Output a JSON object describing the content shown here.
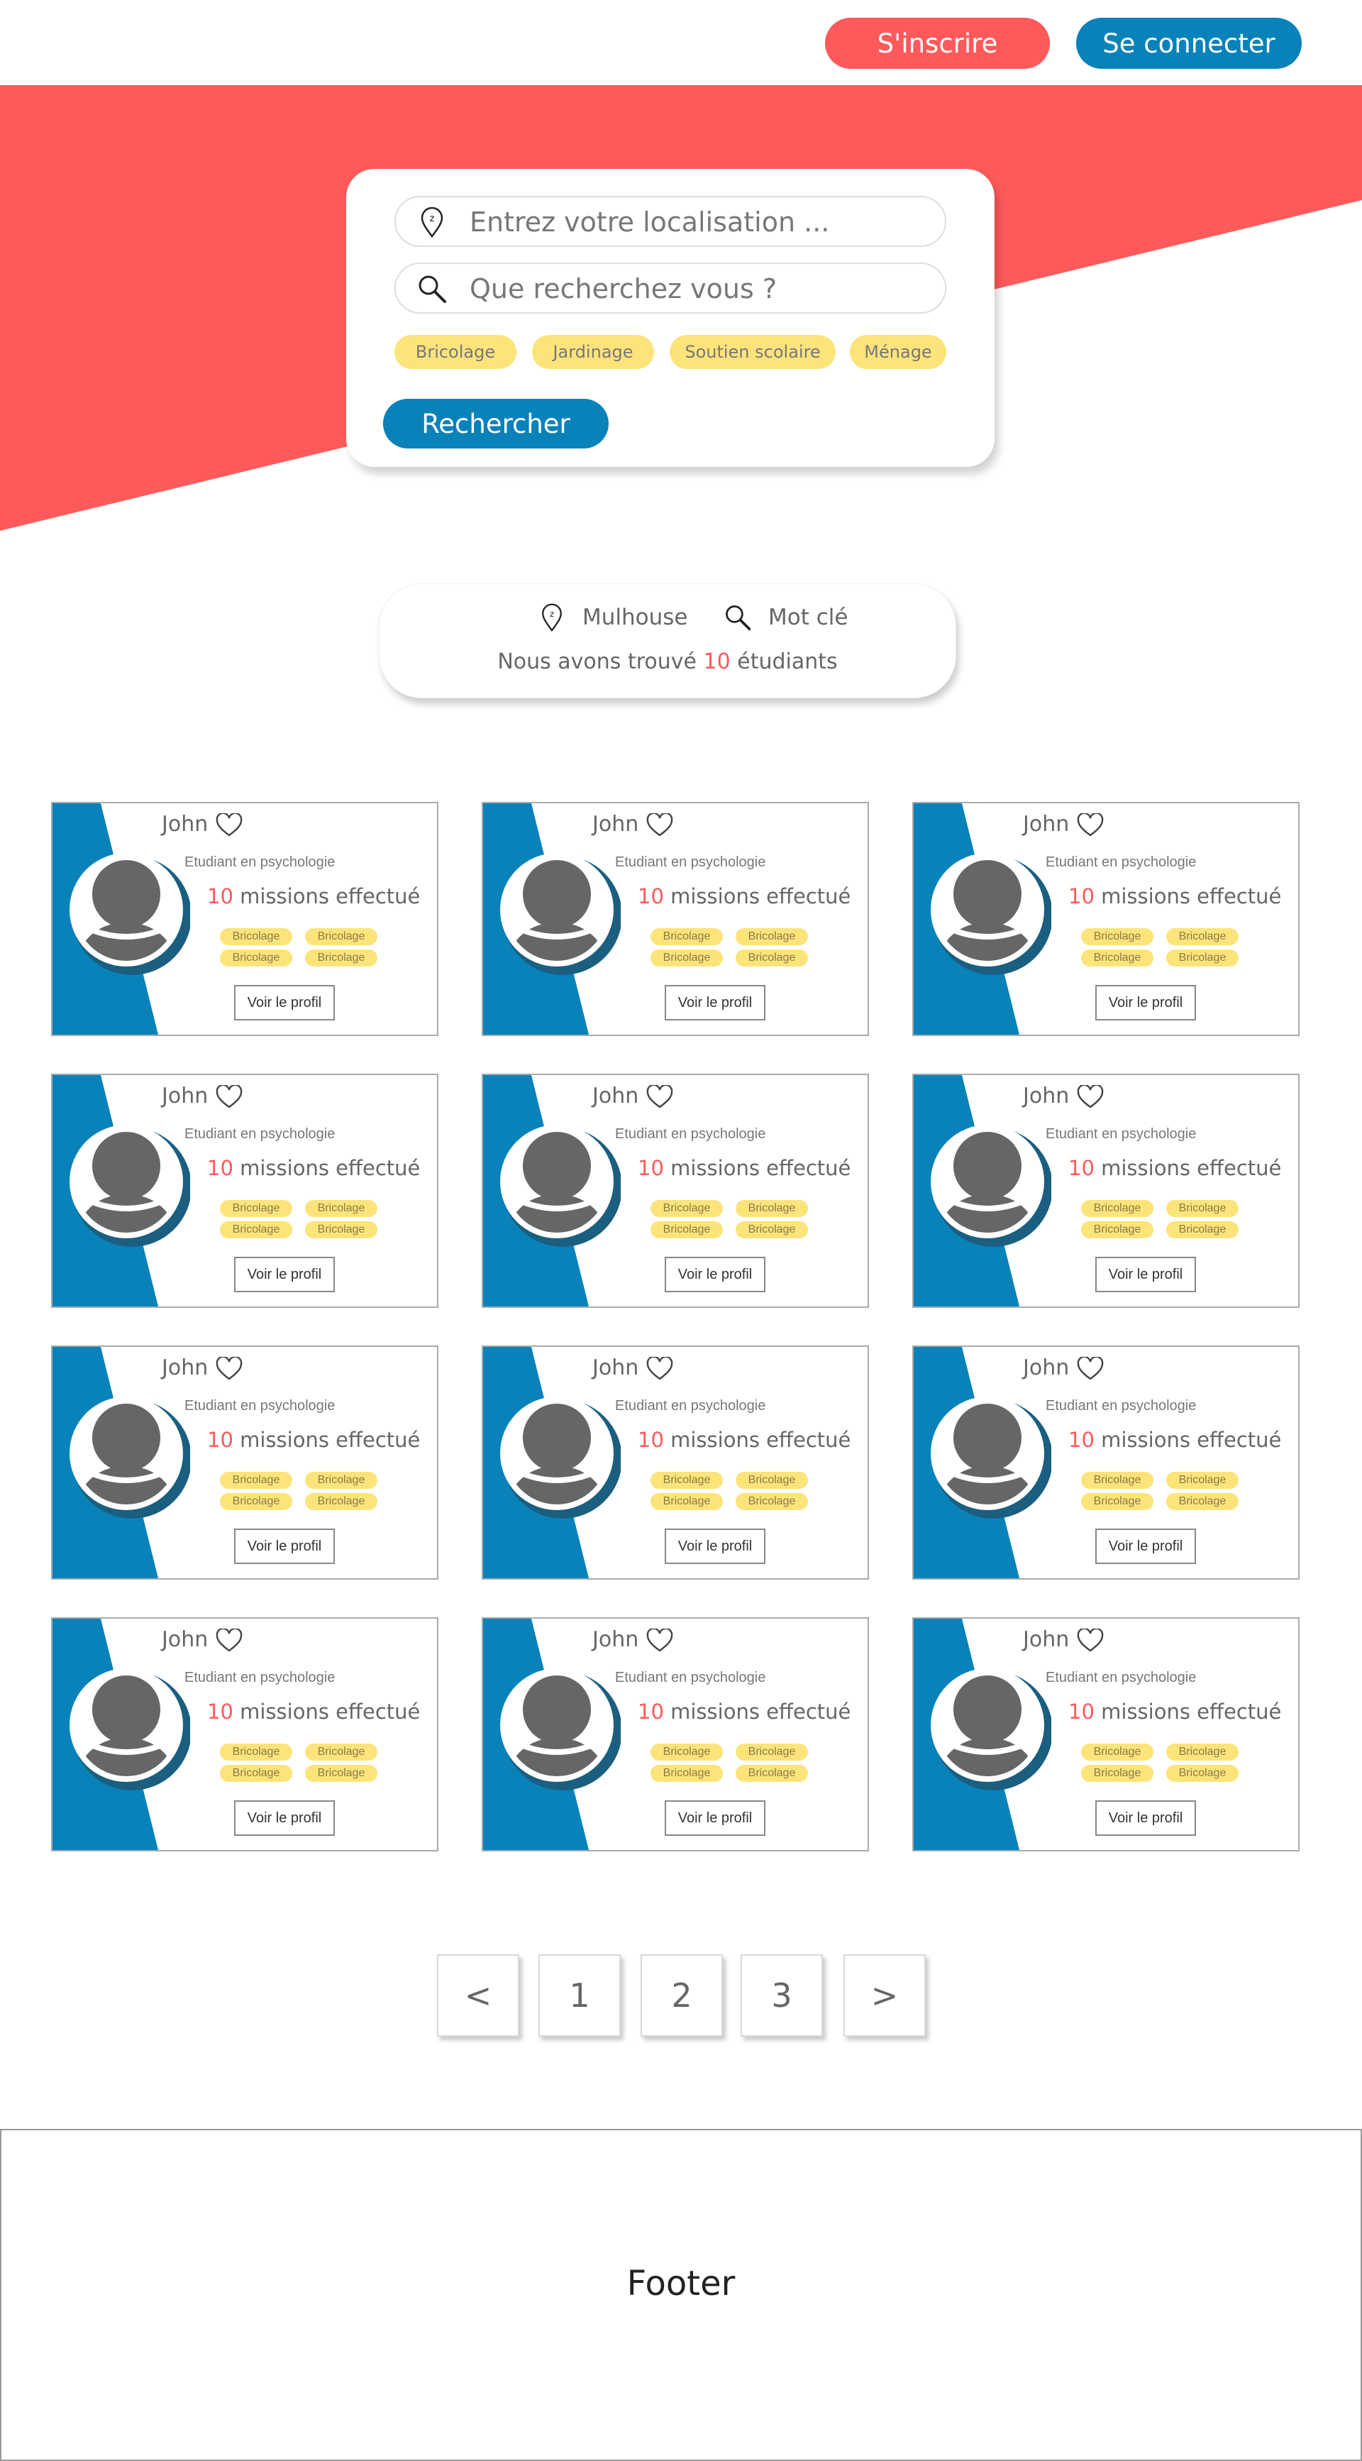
{
  "header": {
    "register_label": "S'inscrire",
    "login_label": "Se connecter"
  },
  "colors": {
    "brand_red": "#fe5a5b",
    "brand_blue": "#0882b9",
    "tag_yellow": "#fde47a",
    "avatar_gray": "#666666"
  },
  "search": {
    "location_placeholder": "Entrez votre localisation ...",
    "location_icon": "map-pin-icon",
    "query_placeholder": "Que recherchez vous ?",
    "query_icon": "search-icon",
    "categories": [
      "Bricolage",
      "Jardinage",
      "Soutien scolaire",
      "Ménage"
    ],
    "submit_label": "Rechercher"
  },
  "summary": {
    "location": "Mulhouse",
    "keyword": "Mot clé",
    "found_prefix": "Nous avons trouvé",
    "found_count": "10",
    "found_suffix": "étudiants"
  },
  "cards": [
    {
      "name": "John",
      "study": "Etudiant en psychologie",
      "missions_count": "10",
      "missions_label": "missions effectué",
      "tags": [
        "Bricolage",
        "Bricolage",
        "Bricolage",
        "Bricolage"
      ],
      "button": "Voir le profil"
    },
    {
      "name": "John",
      "study": "Etudiant en psychologie",
      "missions_count": "10",
      "missions_label": "missions effectué",
      "tags": [
        "Bricolage",
        "Bricolage",
        "Bricolage",
        "Bricolage"
      ],
      "button": "Voir le profil"
    },
    {
      "name": "John",
      "study": "Etudiant en psychologie",
      "missions_count": "10",
      "missions_label": "missions effectué",
      "tags": [
        "Bricolage",
        "Bricolage",
        "Bricolage",
        "Bricolage"
      ],
      "button": "Voir le profil"
    },
    {
      "name": "John",
      "study": "Etudiant en psychologie",
      "missions_count": "10",
      "missions_label": "missions effectué",
      "tags": [
        "Bricolage",
        "Bricolage",
        "Bricolage",
        "Bricolage"
      ],
      "button": "Voir le profil"
    },
    {
      "name": "John",
      "study": "Etudiant en psychologie",
      "missions_count": "10",
      "missions_label": "missions effectué",
      "tags": [
        "Bricolage",
        "Bricolage",
        "Bricolage",
        "Bricolage"
      ],
      "button": "Voir le profil"
    },
    {
      "name": "John",
      "study": "Etudiant en psychologie",
      "missions_count": "10",
      "missions_label": "missions effectué",
      "tags": [
        "Bricolage",
        "Bricolage",
        "Bricolage",
        "Bricolage"
      ],
      "button": "Voir le profil"
    },
    {
      "name": "John",
      "study": "Etudiant en psychologie",
      "missions_count": "10",
      "missions_label": "missions effectué",
      "tags": [
        "Bricolage",
        "Bricolage",
        "Bricolage",
        "Bricolage"
      ],
      "button": "Voir le profil"
    },
    {
      "name": "John",
      "study": "Etudiant en psychologie",
      "missions_count": "10",
      "missions_label": "missions effectué",
      "tags": [
        "Bricolage",
        "Bricolage",
        "Bricolage",
        "Bricolage"
      ],
      "button": "Voir le profil"
    },
    {
      "name": "John",
      "study": "Etudiant en psychologie",
      "missions_count": "10",
      "missions_label": "missions effectué",
      "tags": [
        "Bricolage",
        "Bricolage",
        "Bricolage",
        "Bricolage"
      ],
      "button": "Voir le profil"
    },
    {
      "name": "John",
      "study": "Etudiant en psychologie",
      "missions_count": "10",
      "missions_label": "missions effectué",
      "tags": [
        "Bricolage",
        "Bricolage",
        "Bricolage",
        "Bricolage"
      ],
      "button": "Voir le profil"
    },
    {
      "name": "John",
      "study": "Etudiant en psychologie",
      "missions_count": "10",
      "missions_label": "missions effectué",
      "tags": [
        "Bricolage",
        "Bricolage",
        "Bricolage",
        "Bricolage"
      ],
      "button": "Voir le profil"
    },
    {
      "name": "John",
      "study": "Etudiant en psychologie",
      "missions_count": "10",
      "missions_label": "missions effectué",
      "tags": [
        "Bricolage",
        "Bricolage",
        "Bricolage",
        "Bricolage"
      ],
      "button": "Voir le profil"
    }
  ],
  "pagination": [
    "<",
    "1",
    "2",
    "3",
    ">"
  ],
  "footer": {
    "label": "Footer"
  }
}
